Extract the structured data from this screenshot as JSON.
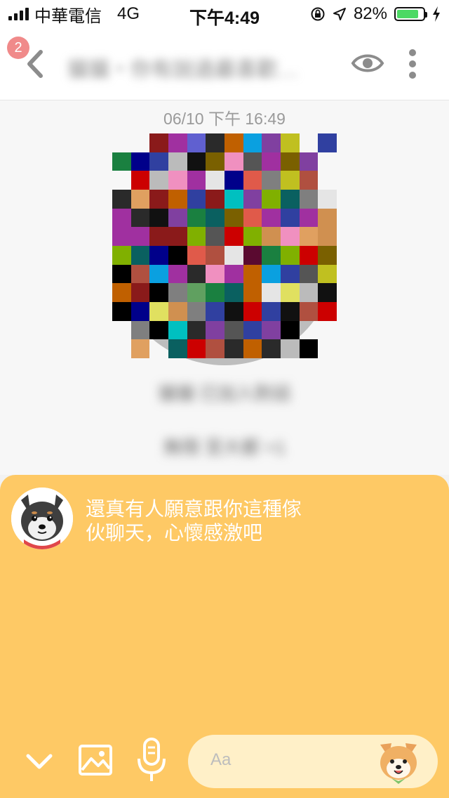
{
  "status_bar": {
    "carrier": "中華電信",
    "network": "4G",
    "time": "下午4:49",
    "battery_percent": "82%",
    "battery_level": 0.82
  },
  "header": {
    "unread_badge": "2",
    "title": "貓貓・你有說過最喜歡…",
    "icons": [
      "chevron-left-icon",
      "eye-icon",
      "more-vertical-icon"
    ]
  },
  "chat": {
    "timestamp": "06/10 下午 16:49",
    "blurred_line_1": "貓貓 已加入對話",
    "blurred_line_2": "無限 至大都 +1"
  },
  "bot_message": {
    "line1": "還真有人願意跟你這種傢",
    "line2": "伙聊天，心懷感激吧"
  },
  "composer": {
    "placeholder": "Aa",
    "icons": [
      "chevron-down-icon",
      "image-icon",
      "microphone-icon",
      "shiba-sticker-icon"
    ]
  },
  "colors": {
    "sheet": "#fec965",
    "badge": "#f08a8a",
    "battery": "#4cd964"
  }
}
